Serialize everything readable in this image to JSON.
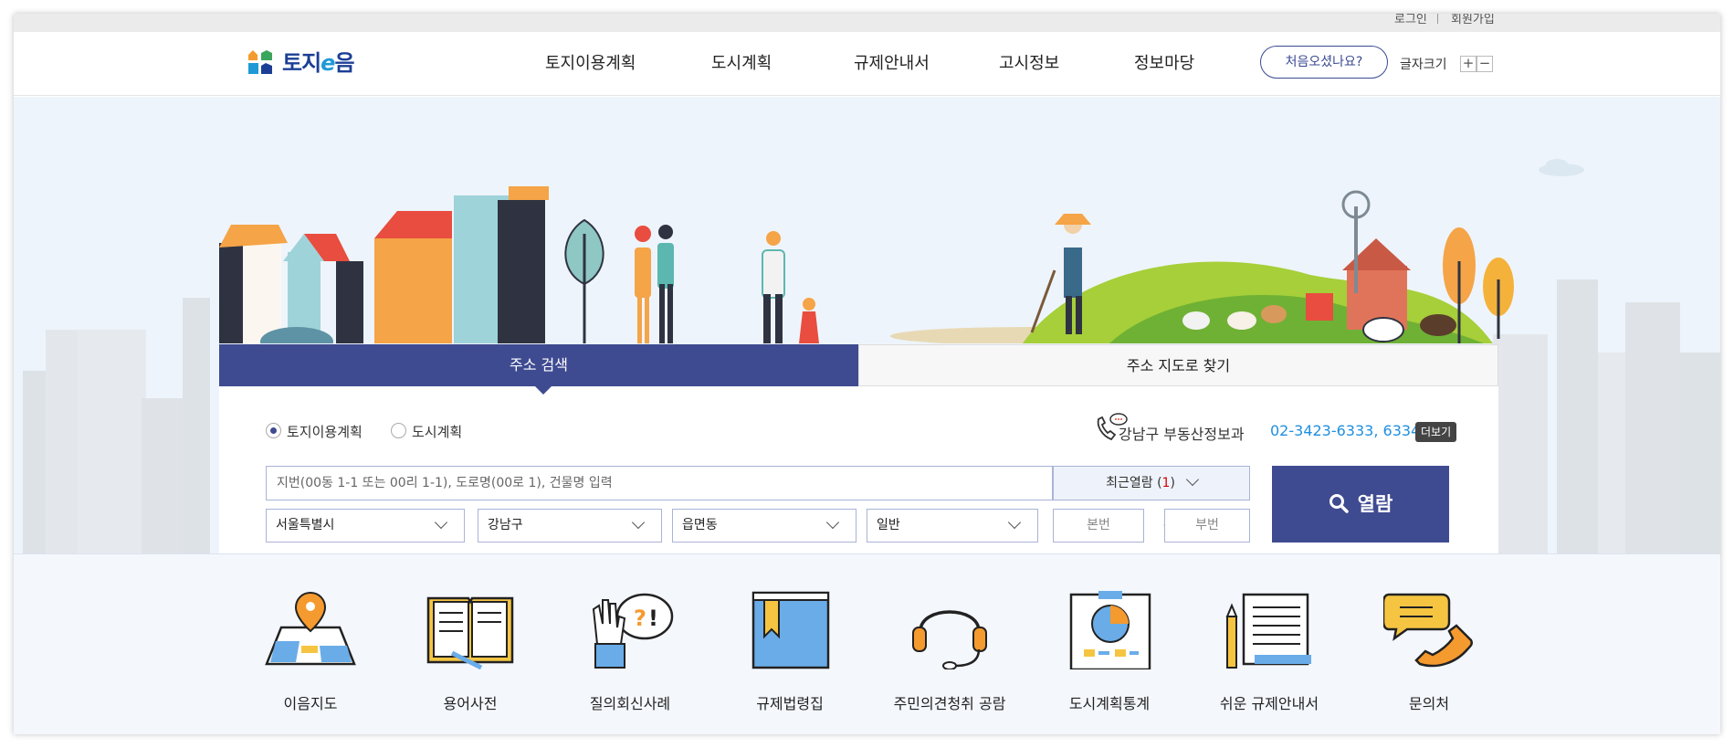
{
  "util": {
    "login": "로그인",
    "signup": "회원가입"
  },
  "logo": {
    "text_a": "토지",
    "text_e": "e",
    "text_b": "음"
  },
  "gnb": [
    "토지이용계획",
    "도시계획",
    "규제안내서",
    "고시정보",
    "정보마당"
  ],
  "header": {
    "first_visit": "처음오셨나요?",
    "font_size_label": "글자크기",
    "plus": "+",
    "minus": "−"
  },
  "tabs": {
    "address_search": "주소 검색",
    "map_search": "주소 지도로 찾기"
  },
  "radio": {
    "land_use": "토지이용계획",
    "city_plan": "도시계획",
    "selected": "토지이용계획"
  },
  "contact": {
    "office": "강남구 부동산정보과",
    "tel": "02-3423-6333, 6334",
    "more": "더보기"
  },
  "search": {
    "placeholder": "지번(00동 1-1 또는 00리 1-1), 도로명(00로 1), 건물명 입력",
    "recent_label": "최근열람",
    "recent_open": "(",
    "recent_count": "1",
    "recent_close": ")",
    "sido": "서울특별시",
    "sigungu": "강남구",
    "emd": "읍면동",
    "type": "일반",
    "bon": "본번",
    "bu": "부번",
    "dash": "-",
    "button": "열람"
  },
  "quick_links": [
    "이음지도",
    "용어사전",
    "질의회신사례",
    "규제법령집",
    "주민의견청취 공람",
    "도시계획통계",
    "쉬운 규제안내서",
    "문의처"
  ],
  "colors": {
    "primary": "#3f4b91",
    "accent_orange": "#f59a2e",
    "accent_blue": "#6aace8",
    "tel_blue": "#1f8fe0"
  }
}
